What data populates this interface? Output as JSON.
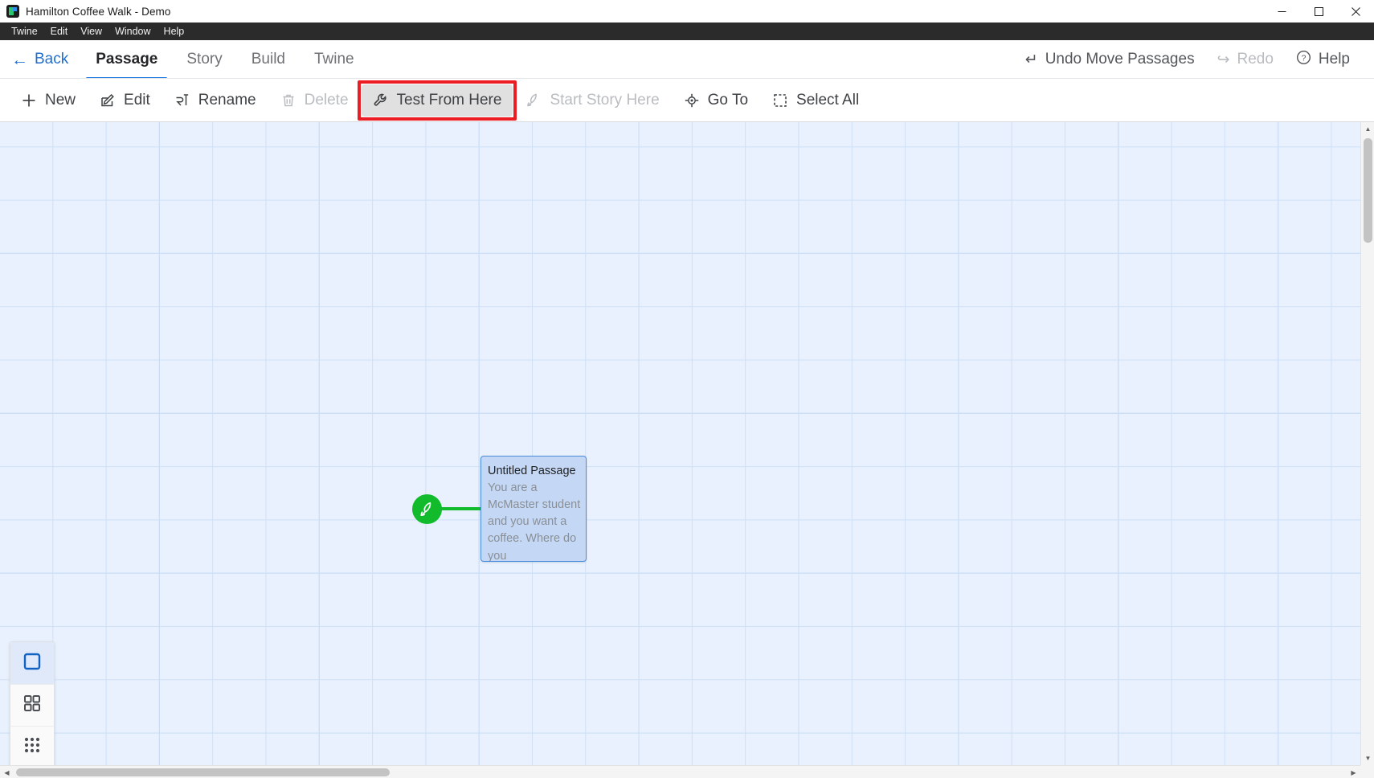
{
  "window": {
    "title": "Hamilton Coffee Walk - Demo",
    "app_icon": "twine-logo-icon",
    "controls": {
      "minimize": "minimize-icon",
      "maximize": "maximize-icon",
      "close": "close-icon"
    }
  },
  "menubar": {
    "items": [
      {
        "label": "Twine"
      },
      {
        "label": "Edit"
      },
      {
        "label": "View"
      },
      {
        "label": "Window"
      },
      {
        "label": "Help"
      }
    ]
  },
  "topnav": {
    "back_label": "Back",
    "back_icon": "arrow-left-icon",
    "tabs": [
      {
        "label": "Passage",
        "active": true
      },
      {
        "label": "Story",
        "active": false
      },
      {
        "label": "Build",
        "active": false
      },
      {
        "label": "Twine",
        "active": false
      }
    ],
    "actions": [
      {
        "label": "Undo Move Passages",
        "icon": "undo-icon",
        "disabled": false
      },
      {
        "label": "Redo",
        "icon": "redo-icon",
        "disabled": true
      },
      {
        "label": "Help",
        "icon": "question-circle-icon",
        "disabled": false
      }
    ]
  },
  "toolbar": {
    "buttons": [
      {
        "label": "New",
        "icon": "plus-icon",
        "disabled": false,
        "hovered": false
      },
      {
        "label": "Edit",
        "icon": "pencil-square-icon",
        "disabled": false,
        "hovered": false
      },
      {
        "label": "Rename",
        "icon": "rename-icon",
        "disabled": false,
        "hovered": false
      },
      {
        "label": "Delete",
        "icon": "trash-icon",
        "disabled": true,
        "hovered": false
      },
      {
        "label": "Test From Here",
        "icon": "wrench-icon",
        "disabled": false,
        "hovered": true,
        "highlighted": true
      },
      {
        "label": "Start Story Here",
        "icon": "rocket-icon",
        "disabled": true,
        "hovered": false
      },
      {
        "label": "Go To",
        "icon": "crosshair-icon",
        "disabled": false,
        "hovered": false
      },
      {
        "label": "Select All",
        "icon": "dashed-square-icon",
        "disabled": false,
        "hovered": false
      }
    ]
  },
  "canvas": {
    "start_marker_icon": "rocket-icon",
    "passages": [
      {
        "title": "Untitled Passage",
        "excerpt": "You are a McMaster student and you want a coffee. Where do you",
        "selected": true
      }
    ]
  },
  "zoom_panel": {
    "levels": [
      {
        "icon": "zoom-large-icon",
        "selected": true
      },
      {
        "icon": "zoom-medium-icon",
        "selected": false
      },
      {
        "icon": "zoom-small-icon",
        "selected": false
      }
    ]
  },
  "scrollbars": {
    "vertical_arrow_up": "chevron-up-icon",
    "vertical_arrow_down": "chevron-down-icon",
    "horizontal_arrow_left": "chevron-left-icon",
    "horizontal_arrow_right": "chevron-right-icon"
  }
}
